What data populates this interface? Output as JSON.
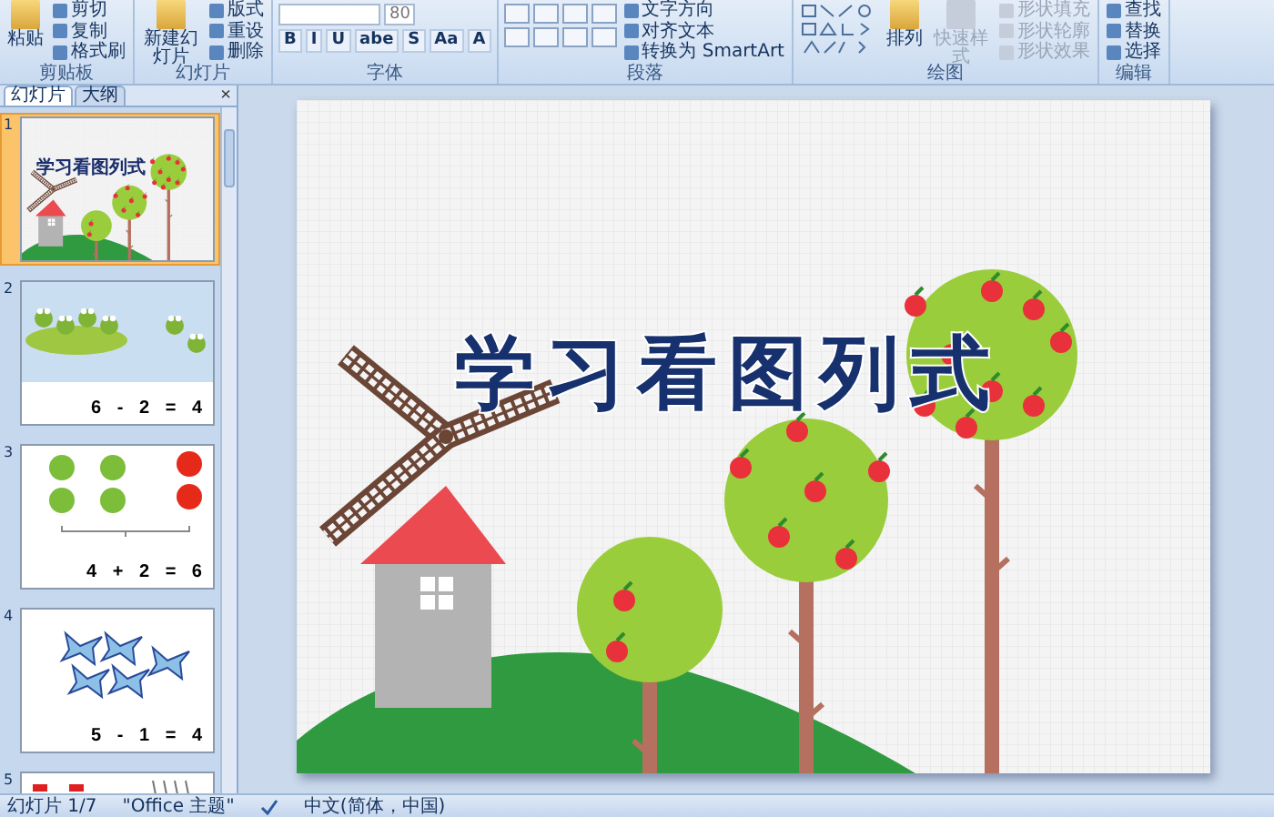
{
  "ribbon": {
    "groups": [
      {
        "label": "剪贴板",
        "kind": "basic",
        "buttons": [
          {
            "label": "粘贴",
            "kind": "large",
            "disabled": false
          },
          {
            "label": "剪切",
            "kind": "small",
            "disabled": false
          },
          {
            "label": "复制",
            "kind": "small",
            "disabled": false
          },
          {
            "label": "格式刷",
            "kind": "small",
            "disabled": false
          }
        ]
      },
      {
        "label": "幻灯片",
        "kind": "basic",
        "buttons": [
          {
            "label": "新建幻灯片",
            "kind": "large",
            "disabled": false
          },
          {
            "label": "版式",
            "kind": "small",
            "disabled": false
          },
          {
            "label": "重设",
            "kind": "small",
            "disabled": false
          },
          {
            "label": "删除",
            "kind": "small",
            "disabled": false
          }
        ]
      },
      {
        "label": "字体",
        "kind": "font",
        "font_size": "80",
        "glyphs": [
          "B",
          "I",
          "U",
          "abe",
          "S",
          "Aa",
          "A"
        ]
      },
      {
        "label": "段落",
        "kind": "paragraph",
        "buttons": [
          {
            "label": "文字方向",
            "kind": "small",
            "disabled": false
          },
          {
            "label": "对齐文本",
            "kind": "small",
            "disabled": false
          },
          {
            "label": "转换为 SmartArt",
            "kind": "small",
            "disabled": false
          }
        ]
      },
      {
        "label": "绘图",
        "kind": "drawing",
        "buttons": [
          {
            "label": "排列",
            "kind": "large",
            "disabled": false
          },
          {
            "label": "快速样式",
            "kind": "large",
            "disabled": true
          },
          {
            "label": "形状填充",
            "kind": "small",
            "disabled": true
          },
          {
            "label": "形状轮廓",
            "kind": "small",
            "disabled": true
          },
          {
            "label": "形状效果",
            "kind": "small",
            "disabled": true
          }
        ]
      },
      {
        "label": "编辑",
        "kind": "basic",
        "buttons": [
          {
            "label": "查找",
            "kind": "small",
            "disabled": false
          },
          {
            "label": "替换",
            "kind": "small",
            "disabled": false
          },
          {
            "label": "选择",
            "kind": "small",
            "disabled": false
          }
        ]
      }
    ]
  },
  "panel": {
    "tabs": [
      {
        "label": "幻灯片",
        "selected": true
      },
      {
        "label": "大纲",
        "selected": false
      }
    ],
    "close": "×",
    "slides": [
      {
        "number": "1",
        "kind": "title",
        "selected": true,
        "title": "学习看图列式"
      },
      {
        "number": "2",
        "kind": "frogs",
        "selected": false,
        "equation": "6 - 2 = 4"
      },
      {
        "number": "3",
        "kind": "apples",
        "selected": false,
        "equation": "4 + 2 = 6"
      },
      {
        "number": "4",
        "kind": "butterflies",
        "selected": false,
        "equation": "5 - 1 = 4"
      },
      {
        "number": "5",
        "kind": "partial",
        "selected": false
      }
    ]
  },
  "slide": {
    "title": "学习看图列式"
  },
  "status_bar": {
    "items": [
      "幻灯片 1/7",
      "\"Office 主题\"",
      "中文(简体，中国)"
    ]
  }
}
